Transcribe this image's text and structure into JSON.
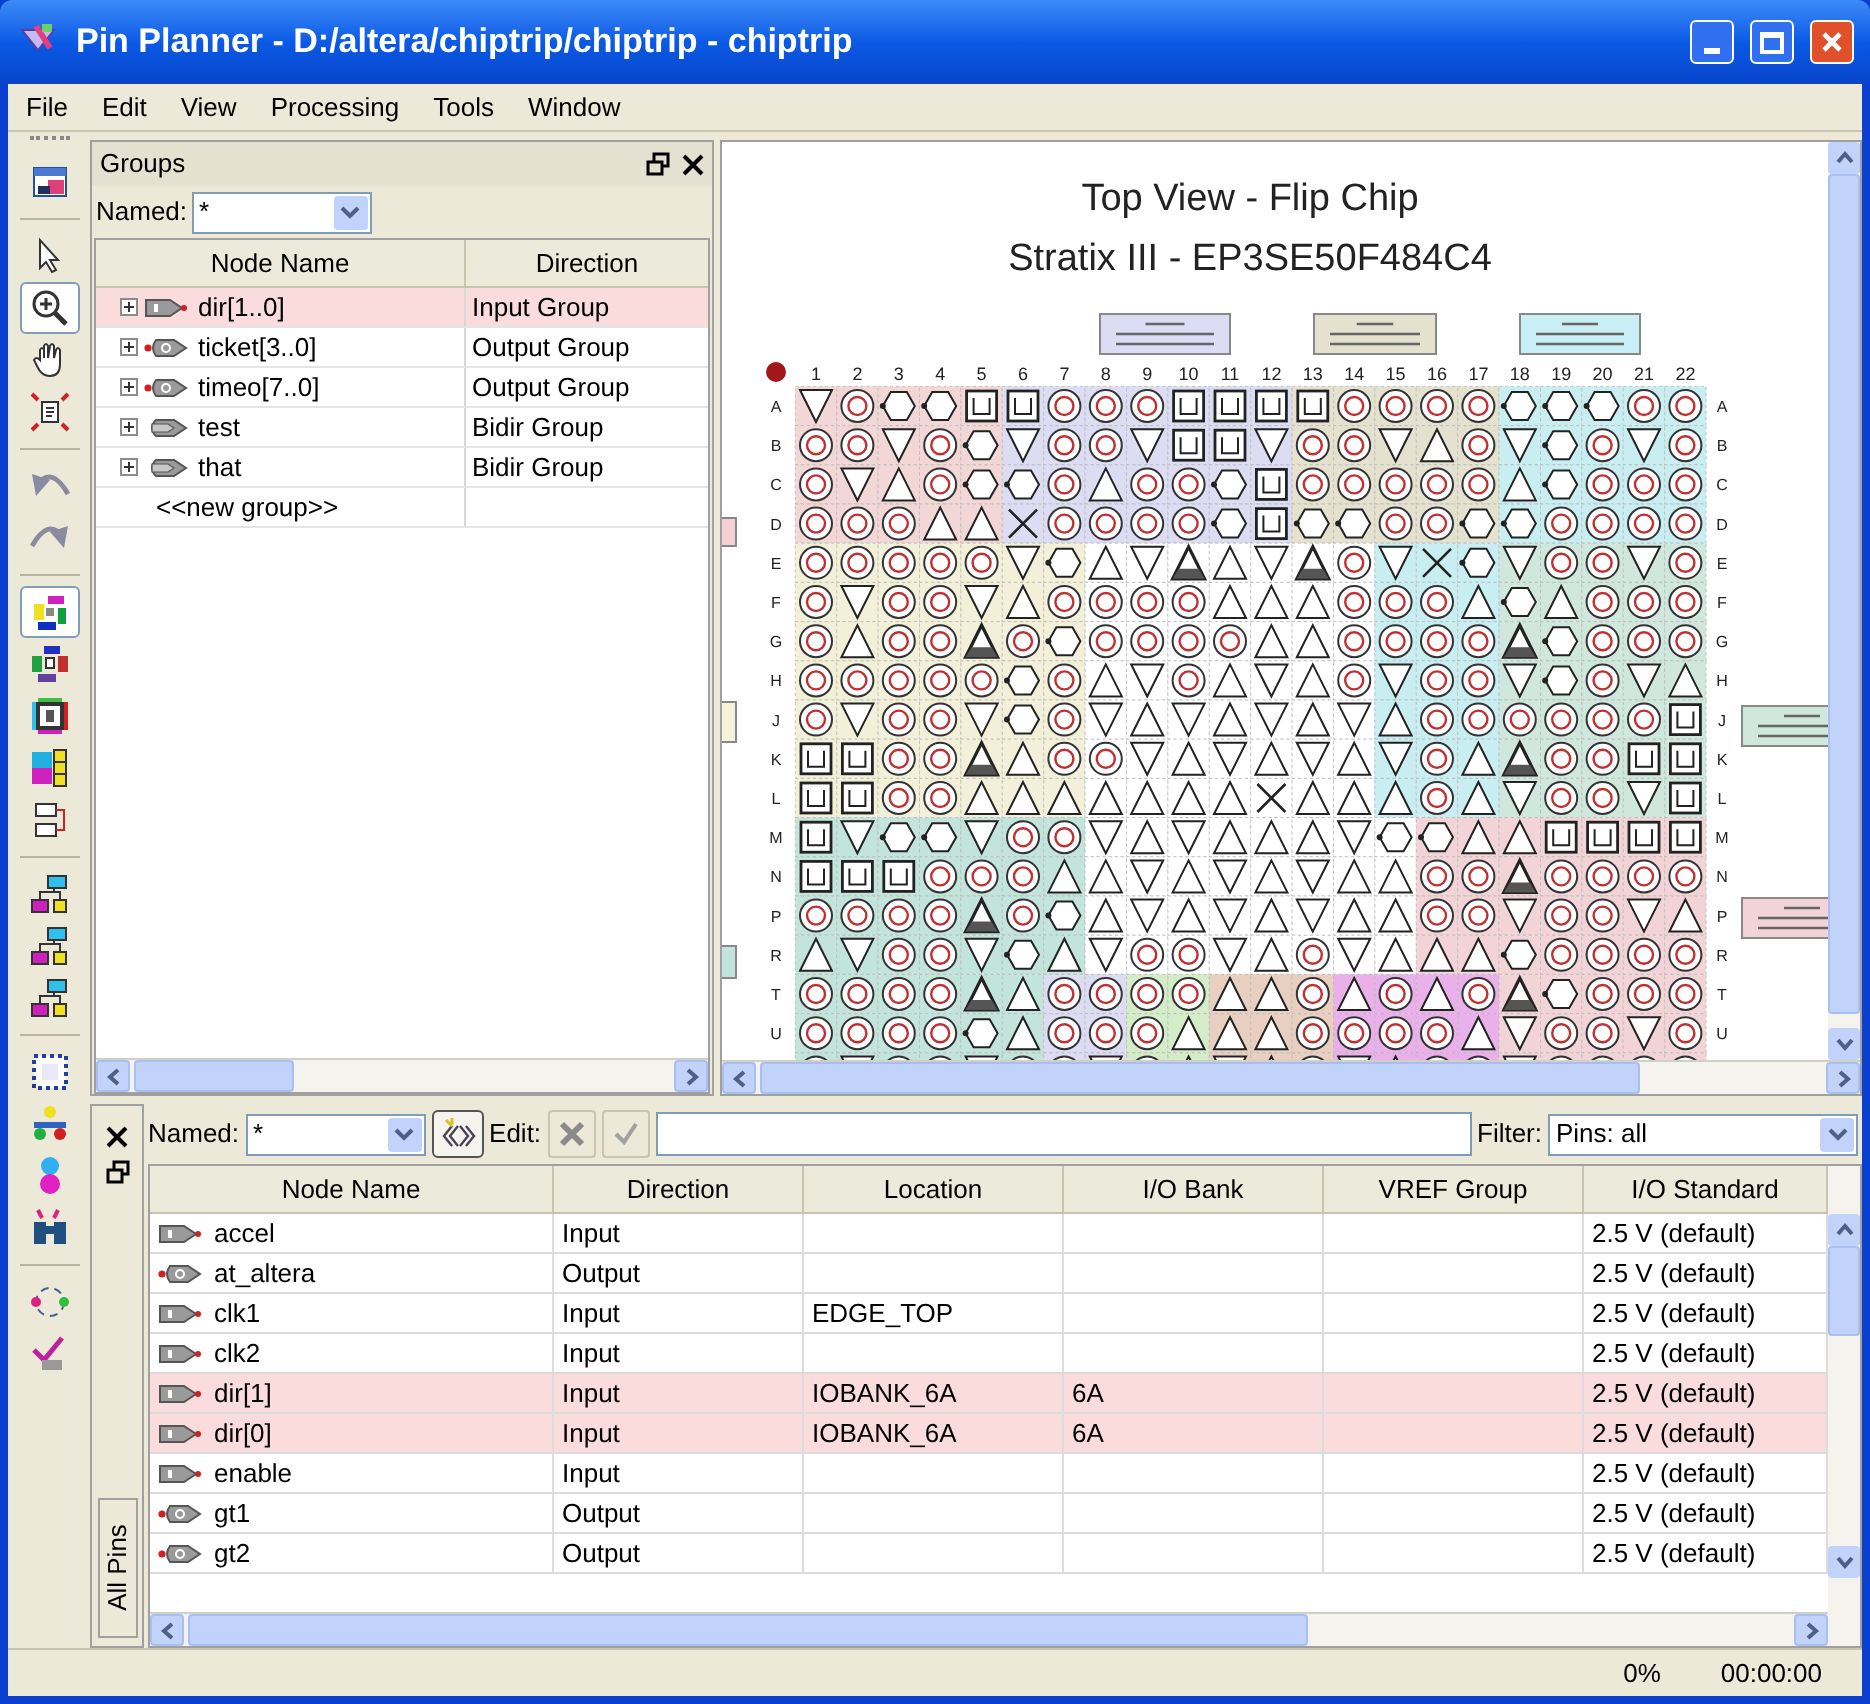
{
  "window": {
    "title": "Pin Planner - D:/altera/chiptrip/chiptrip - chiptrip"
  },
  "menu": [
    "File",
    "Edit",
    "View",
    "Processing",
    "Tools",
    "Window"
  ],
  "toolbar": [
    [
      {
        "kind": "window",
        "selected": false
      }
    ],
    [
      {
        "kind": "pointer",
        "selected": false
      },
      {
        "kind": "zoom",
        "selected": true
      },
      {
        "kind": "hand",
        "selected": false
      },
      {
        "kind": "fit",
        "selected": false
      }
    ],
    [
      {
        "kind": "undo",
        "selected": false
      },
      {
        "kind": "redo",
        "selected": false
      }
    ],
    [
      {
        "kind": "pins",
        "selected": true
      },
      {
        "kind": "vpins",
        "selected": false
      },
      {
        "kind": "edge",
        "selected": false
      },
      {
        "kind": "blocks",
        "selected": false
      },
      {
        "kind": "flow",
        "selected": false
      }
    ],
    [
      {
        "kind": "tree",
        "selected": false
      },
      {
        "kind": "tree",
        "selected": false
      },
      {
        "kind": "tree",
        "selected": false
      }
    ],
    [
      {
        "kind": "package",
        "selected": false
      },
      {
        "kind": "net",
        "selected": false
      },
      {
        "kind": "help",
        "selected": false
      },
      {
        "kind": "find",
        "selected": false
      }
    ],
    [
      {
        "kind": "cycle",
        "selected": false
      },
      {
        "kind": "check",
        "selected": false
      }
    ]
  ],
  "groups": {
    "title": "Groups",
    "named_label": "Named:",
    "named_value": "*",
    "columns": [
      "Node Name",
      "Direction"
    ],
    "rows": [
      {
        "kind": "input",
        "name": "dir[1..0]",
        "direction": "Input Group",
        "expanded": false,
        "selected": true
      },
      {
        "kind": "output",
        "name": "ticket[3..0]",
        "direction": "Output Group",
        "expanded": false,
        "selected": false
      },
      {
        "kind": "output",
        "name": "timeo[7..0]",
        "direction": "Output Group",
        "expanded": false,
        "selected": false
      },
      {
        "kind": "bidir",
        "name": "test",
        "direction": "Bidir Group",
        "expanded": false,
        "selected": false
      },
      {
        "kind": "bidir",
        "name": "that",
        "direction": "Bidir Group",
        "expanded": false,
        "selected": false
      }
    ],
    "new_group": "<<new group>>"
  },
  "chip_view": {
    "title": "Top View - Flip Chip",
    "subtitle": "Stratix III - EP3SE50F484C4",
    "column_numbers": [
      "1",
      "2",
      "3",
      "4",
      "5",
      "6",
      "7",
      "8",
      "9",
      "10",
      "11",
      "12",
      "13",
      "14",
      "15",
      "16",
      "17",
      "18",
      "19",
      "20",
      "21",
      "22"
    ],
    "row_labels_left": [
      "A",
      "B",
      "C",
      "D",
      "E",
      "F",
      "G",
      "H",
      "J",
      "K",
      "L",
      "M",
      "N",
      "P",
      "R",
      "T",
      "U"
    ],
    "row_labels_right": [
      "A",
      "B",
      "C",
      "D",
      "E",
      "F",
      "G",
      "H",
      "J",
      "K",
      "L",
      "M",
      "N",
      "P",
      "R",
      "T",
      "U"
    ]
  },
  "pins": {
    "tab": "All Pins",
    "named_label": "Named:",
    "named_value": "*",
    "edit_label": "Edit:",
    "filter_label": "Filter:",
    "filter_value": "Pins: all",
    "columns": [
      "Node Name",
      "Direction",
      "Location",
      "I/O Bank",
      "VREF Group",
      "I/O Standard"
    ],
    "rows": [
      {
        "kind": "input",
        "selected": false,
        "name": "accel",
        "direction": "Input",
        "io_standard": "2.5 V (default)"
      },
      {
        "kind": "output",
        "selected": false,
        "name": "at_altera",
        "direction": "Output",
        "io_standard": "2.5 V (default)"
      },
      {
        "kind": "input",
        "selected": false,
        "name": "clk1",
        "direction": "Input",
        "location": "EDGE_TOP",
        "io_standard": "2.5 V (default)"
      },
      {
        "kind": "input",
        "selected": false,
        "name": "clk2",
        "direction": "Input",
        "io_standard": "2.5 V (default)"
      },
      {
        "kind": "input",
        "selected": true,
        "name": "dir[1]",
        "direction": "Input",
        "location": "IOBANK_6A",
        "io_bank": "6A",
        "io_standard": "2.5 V (default)"
      },
      {
        "kind": "input",
        "selected": true,
        "name": "dir[0]",
        "direction": "Input",
        "location": "IOBANK_6A",
        "io_bank": "6A",
        "io_standard": "2.5 V (default)"
      },
      {
        "kind": "input",
        "selected": false,
        "name": "enable",
        "direction": "Input",
        "io_standard": "2.5 V (default)"
      },
      {
        "kind": "output",
        "selected": false,
        "name": "gt1",
        "direction": "Output",
        "io_standard": "2.5 V (default)"
      },
      {
        "kind": "output",
        "selected": false,
        "name": "gt2",
        "direction": "Output",
        "io_standard": "2.5 V (default)"
      }
    ]
  },
  "status_bar": {
    "progress": "0%",
    "elapsed": "00:00:00"
  }
}
